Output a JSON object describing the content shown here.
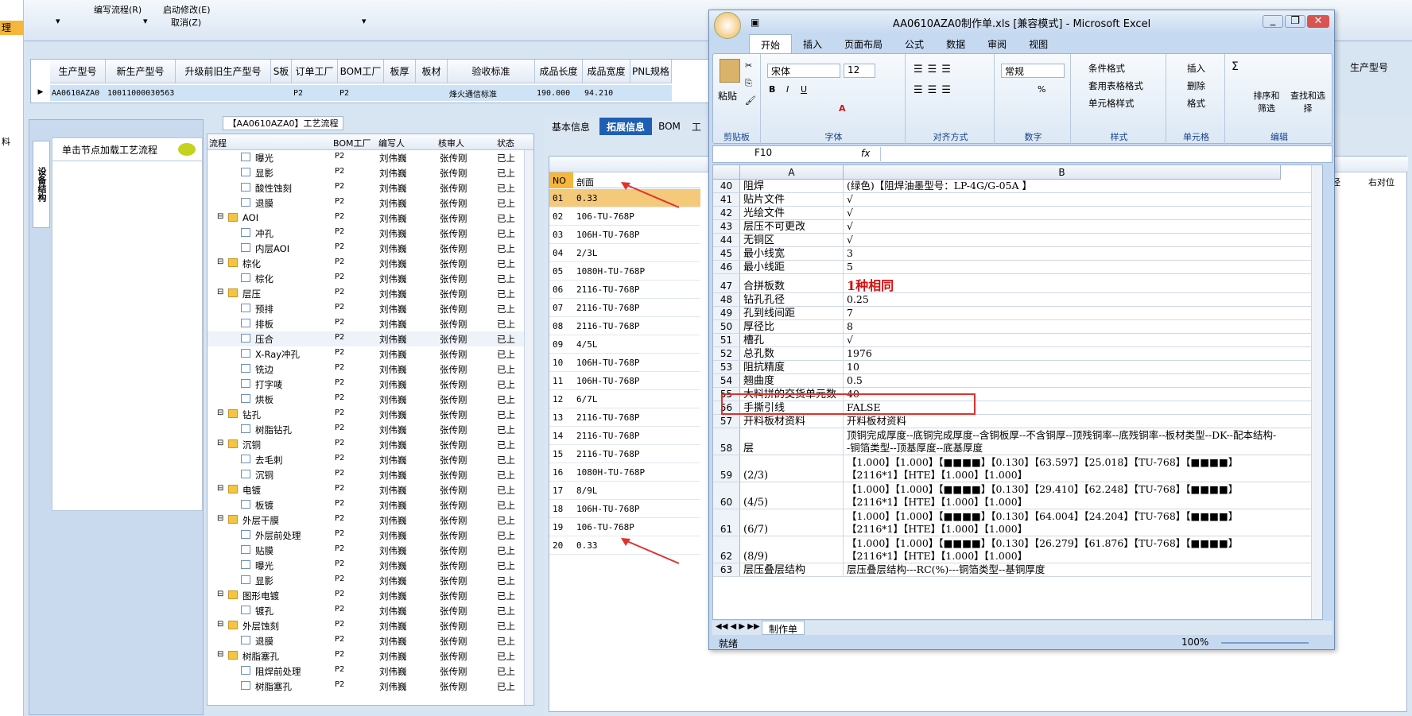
{
  "toolbar": {
    "edit_flow": "编写流程(R)",
    "start_edit": "启动修改(E)",
    "cancel": "取消(Z)"
  },
  "left_strip": {
    "item1": "理",
    "item2": "料"
  },
  "order_grid": {
    "headers": [
      "生产型号",
      "新生产型号",
      "升级前旧生产型号",
      "S板",
      "订单工厂",
      "BOM工厂",
      "板厚",
      "板材",
      "验收标准",
      "成品长度",
      "成品宽度",
      "PNL规格"
    ],
    "row": [
      "AA0610AZA0",
      "10011000030563",
      "",
      "",
      "P2",
      "P2",
      "",
      "",
      "烽火通信标准",
      "190.000",
      "94.210",
      ""
    ]
  },
  "left_panel": {
    "vtab": "设备结构",
    "title": "单击节点加载工艺流程"
  },
  "flow_caption": "【AA0610AZA0】工艺流程",
  "tree": {
    "headers": [
      "流程",
      "BOM工厂",
      "编写人",
      "核审人",
      "状态"
    ],
    "rows": [
      {
        "indent": 2,
        "folder": false,
        "name": "曝光",
        "bom": "P2",
        "writer": "刘伟巍",
        "reviewer": "张传刚",
        "status": "已上"
      },
      {
        "indent": 2,
        "folder": false,
        "name": "显影",
        "bom": "P2",
        "writer": "刘伟巍",
        "reviewer": "张传刚",
        "status": "已上"
      },
      {
        "indent": 2,
        "folder": false,
        "name": "酸性蚀刻",
        "bom": "P2",
        "writer": "刘伟巍",
        "reviewer": "张传刚",
        "status": "已上"
      },
      {
        "indent": 2,
        "folder": false,
        "name": "退膜",
        "bom": "P2",
        "writer": "刘伟巍",
        "reviewer": "张传刚",
        "status": "已上"
      },
      {
        "indent": 1,
        "folder": true,
        "name": "AOI",
        "bom": "P2",
        "writer": "刘伟巍",
        "reviewer": "张传刚",
        "status": "已上"
      },
      {
        "indent": 2,
        "folder": false,
        "name": "冲孔",
        "bom": "P2",
        "writer": "刘伟巍",
        "reviewer": "张传刚",
        "status": "已上"
      },
      {
        "indent": 2,
        "folder": false,
        "name": "内层AOI",
        "bom": "P2",
        "writer": "刘伟巍",
        "reviewer": "张传刚",
        "status": "已上"
      },
      {
        "indent": 1,
        "folder": true,
        "name": "棕化",
        "bom": "P2",
        "writer": "刘伟巍",
        "reviewer": "张传刚",
        "status": "已上"
      },
      {
        "indent": 2,
        "folder": false,
        "name": "棕化",
        "bom": "P2",
        "writer": "刘伟巍",
        "reviewer": "张传刚",
        "status": "已上"
      },
      {
        "indent": 1,
        "folder": true,
        "name": "层压",
        "bom": "P2",
        "writer": "刘伟巍",
        "reviewer": "张传刚",
        "status": "已上"
      },
      {
        "indent": 2,
        "folder": false,
        "name": "预排",
        "bom": "P2",
        "writer": "刘伟巍",
        "reviewer": "张传刚",
        "status": "已上"
      },
      {
        "indent": 2,
        "folder": false,
        "name": "排板",
        "bom": "P2",
        "writer": "刘伟巍",
        "reviewer": "张传刚",
        "status": "已上"
      },
      {
        "indent": 2,
        "folder": false,
        "name": "压合",
        "bom": "P2",
        "writer": "刘伟巍",
        "reviewer": "张传刚",
        "status": "已上"
      },
      {
        "indent": 2,
        "folder": false,
        "name": "X-Ray冲孔",
        "bom": "P2",
        "writer": "刘伟巍",
        "reviewer": "张传刚",
        "status": "已上"
      },
      {
        "indent": 2,
        "folder": false,
        "name": "铣边",
        "bom": "P2",
        "writer": "刘伟巍",
        "reviewer": "张传刚",
        "status": "已上"
      },
      {
        "indent": 2,
        "folder": false,
        "name": "打字唛",
        "bom": "P2",
        "writer": "刘伟巍",
        "reviewer": "张传刚",
        "status": "已上"
      },
      {
        "indent": 2,
        "folder": false,
        "name": "烘板",
        "bom": "P2",
        "writer": "刘伟巍",
        "reviewer": "张传刚",
        "status": "已上"
      },
      {
        "indent": 1,
        "folder": true,
        "name": "钻孔",
        "bom": "P2",
        "writer": "刘伟巍",
        "reviewer": "张传刚",
        "status": "已上"
      },
      {
        "indent": 2,
        "folder": false,
        "name": "树脂钻孔",
        "bom": "P2",
        "writer": "刘伟巍",
        "reviewer": "张传刚",
        "status": "已上"
      },
      {
        "indent": 1,
        "folder": true,
        "name": "沉铜",
        "bom": "P2",
        "writer": "刘伟巍",
        "reviewer": "张传刚",
        "status": "已上"
      },
      {
        "indent": 2,
        "folder": false,
        "name": "去毛刺",
        "bom": "P2",
        "writer": "刘伟巍",
        "reviewer": "张传刚",
        "status": "已上"
      },
      {
        "indent": 2,
        "folder": false,
        "name": "沉铜",
        "bom": "P2",
        "writer": "刘伟巍",
        "reviewer": "张传刚",
        "status": "已上"
      },
      {
        "indent": 1,
        "folder": true,
        "name": "电镀",
        "bom": "P2",
        "writer": "刘伟巍",
        "reviewer": "张传刚",
        "status": "已上"
      },
      {
        "indent": 2,
        "folder": false,
        "name": "板镀",
        "bom": "P2",
        "writer": "刘伟巍",
        "reviewer": "张传刚",
        "status": "已上"
      },
      {
        "indent": 1,
        "folder": true,
        "name": "外层干膜",
        "bom": "P2",
        "writer": "刘伟巍",
        "reviewer": "张传刚",
        "status": "已上"
      },
      {
        "indent": 2,
        "folder": false,
        "name": "外层前处理",
        "bom": "P2",
        "writer": "刘伟巍",
        "reviewer": "张传刚",
        "status": "已上"
      },
      {
        "indent": 2,
        "folder": false,
        "name": "贴膜",
        "bom": "P2",
        "writer": "刘伟巍",
        "reviewer": "张传刚",
        "status": "已上"
      },
      {
        "indent": 2,
        "folder": false,
        "name": "曝光",
        "bom": "P2",
        "writer": "刘伟巍",
        "reviewer": "张传刚",
        "status": "已上"
      },
      {
        "indent": 2,
        "folder": false,
        "name": "显影",
        "bom": "P2",
        "writer": "刘伟巍",
        "reviewer": "张传刚",
        "status": "已上"
      },
      {
        "indent": 1,
        "folder": true,
        "name": "图形电镀",
        "bom": "P2",
        "writer": "刘伟巍",
        "reviewer": "张传刚",
        "status": "已上"
      },
      {
        "indent": 2,
        "folder": false,
        "name": "镀孔",
        "bom": "P2",
        "writer": "刘伟巍",
        "reviewer": "张传刚",
        "status": "已上"
      },
      {
        "indent": 1,
        "folder": true,
        "name": "外层蚀刻",
        "bom": "P2",
        "writer": "刘伟巍",
        "reviewer": "张传刚",
        "status": "已上"
      },
      {
        "indent": 2,
        "folder": false,
        "name": "退膜",
        "bom": "P2",
        "writer": "刘伟巍",
        "reviewer": "张传刚",
        "status": "已上"
      },
      {
        "indent": 1,
        "folder": true,
        "name": "树脂塞孔",
        "bom": "P2",
        "writer": "刘伟巍",
        "reviewer": "张传刚",
        "status": "已上"
      },
      {
        "indent": 2,
        "folder": false,
        "name": "阻焊前处理",
        "bom": "P2",
        "writer": "刘伟巍",
        "reviewer": "张传刚",
        "status": "已上"
      },
      {
        "indent": 2,
        "folder": false,
        "name": "树脂塞孔",
        "bom": "P2",
        "writer": "刘伟巍",
        "reviewer": "张传刚",
        "status": "已上"
      }
    ]
  },
  "right_tabs": [
    "基本信息",
    "拓展信息",
    "BOM",
    "工"
  ],
  "right_grid": {
    "headers": [
      "NO",
      "剖面"
    ],
    "extra_headers": [
      "生产型号",
      "径",
      "右对位"
    ],
    "rows": [
      [
        "01",
        "0.33"
      ],
      [
        "02",
        "106-TU-768P"
      ],
      [
        "03",
        "106H-TU-768P"
      ],
      [
        "04",
        "2/3L"
      ],
      [
        "05",
        "1080H-TU-768P"
      ],
      [
        "06",
        "2116-TU-768P"
      ],
      [
        "07",
        "2116-TU-768P"
      ],
      [
        "08",
        "2116-TU-768P"
      ],
      [
        "09",
        "4/5L"
      ],
      [
        "10",
        "106H-TU-768P"
      ],
      [
        "11",
        "106H-TU-768P"
      ],
      [
        "12",
        "6/7L"
      ],
      [
        "13",
        "2116-TU-768P"
      ],
      [
        "14",
        "2116-TU-768P"
      ],
      [
        "15",
        "2116-TU-768P"
      ],
      [
        "16",
        "1080H-TU-768P"
      ],
      [
        "17",
        "8/9L"
      ],
      [
        "18",
        "106H-TU-768P"
      ],
      [
        "19",
        "106-TU-768P"
      ],
      [
        "20",
        "0.33"
      ]
    ]
  },
  "excel": {
    "title": "AA0610AZA0制作单.xls  [兼容模式] - Microsoft Excel",
    "tabs": [
      "开始",
      "插入",
      "页面布局",
      "公式",
      "数据",
      "审阅",
      "视图"
    ],
    "ribbon": {
      "paste": "粘贴",
      "clipboard": "剪贴板",
      "font_name": "宋体",
      "font_size": "12",
      "font_group": "字体",
      "align_group": "对齐方式",
      "number_format": "常规",
      "number_group": "数字",
      "cond_format": "条件格式",
      "table_format": "套用表格格式",
      "cell_style": "单元格样式",
      "style_group": "样式",
      "insert": "插入",
      "delete": "删除",
      "format": "格式",
      "cells_group": "单元格",
      "sort_filter": "排序和筛选",
      "find_select": "查找和选择",
      "edit_group": "编辑"
    },
    "name_box": "F10",
    "fx": "fx",
    "col_a": "A",
    "col_b": "B",
    "rows": [
      {
        "n": "40",
        "a": "阻焊",
        "b": "(绿色)【阻焊油墨型号：LP-4G/G-05A 】",
        "h": 17
      },
      {
        "n": "41",
        "a": "贴片文件",
        "b": "√",
        "h": 17
      },
      {
        "n": "42",
        "a": "光绘文件",
        "b": "√",
        "h": 17
      },
      {
        "n": "43",
        "a": "层压不可更改",
        "b": "√",
        "h": 17
      },
      {
        "n": "44",
        "a": "无铜区",
        "b": "√",
        "h": 17
      },
      {
        "n": "45",
        "a": "最小线宽",
        "b": "3",
        "h": 17
      },
      {
        "n": "46",
        "a": "最小线距",
        "b": "5",
        "h": 17
      },
      {
        "n": "47",
        "a": "合拼板数",
        "b": "1种相同",
        "h": 24,
        "red": true
      },
      {
        "n": "48",
        "a": "钻孔孔径",
        "b": "0.25",
        "h": 17
      },
      {
        "n": "49",
        "a": "孔到线间距",
        "b": "7",
        "h": 17
      },
      {
        "n": "50",
        "a": "厚径比",
        "b": "8",
        "h": 17
      },
      {
        "n": "51",
        "a": "槽孔",
        "b": "√",
        "h": 17
      },
      {
        "n": "52",
        "a": "总孔数",
        "b": "1976",
        "h": 17
      },
      {
        "n": "53",
        "a": "阻抗精度",
        "b": "10",
        "h": 17
      },
      {
        "n": "54",
        "a": "翘曲度",
        "b": "0.5",
        "h": 17
      },
      {
        "n": "55",
        "a": "大料拼的交货单元数",
        "b": "40",
        "h": 17
      },
      {
        "n": "56",
        "a": "手撕引线",
        "b": "FALSE",
        "h": 17
      },
      {
        "n": "57",
        "a": "开料板材资料",
        "b": "开料板材资料",
        "h": 17
      },
      {
        "n": "58",
        "a": "层",
        "b": "顶铜完成厚度--底铜完成厚度--含铜板厚--不含铜厚--顶残铜率--底残铜率--板材类型--DK--配本结构--铜箔类型--顶基厚度--底基厚度",
        "h": 34
      },
      {
        "n": "59",
        "a": "(2/3)",
        "b": "【1.000】【1.000】【■■■■】【0.130】【63.597】【25.018】【TU-768】【■■■■】【2116*1】【HTE】【1.000】【1.000】",
        "h": 34
      },
      {
        "n": "60",
        "a": "(4/5)",
        "b": "【1.000】【1.000】【■■■■】【0.130】【29.410】【62.248】【TU-768】【■■■■】【2116*1】【HTE】【1.000】【1.000】",
        "h": 34
      },
      {
        "n": "61",
        "a": "(6/7)",
        "b": "【1.000】【1.000】【■■■■】【0.130】【64.004】【24.204】【TU-768】【■■■■】【2116*1】【HTE】【1.000】【1.000】",
        "h": 34
      },
      {
        "n": "62",
        "a": "(8/9)",
        "b": "【1.000】【1.000】【■■■■】【0.130】【26.279】【61.876】【TU-768】【■■■■】【2116*1】【HTE】【1.000】【1.000】",
        "h": 34
      },
      {
        "n": "63",
        "a": "层压叠层结构",
        "b": "层压叠层结构---RC(%)---铜箔类型--基铜厚度",
        "h": 17
      }
    ],
    "sheet_tab": "制作单",
    "status": "就绪",
    "zoom": "100%"
  },
  "colors": {
    "accent": "#1e5fb4",
    "highlight": "#f5b63c",
    "annotation": "#e0312b",
    "red_text": "#d41010"
  }
}
